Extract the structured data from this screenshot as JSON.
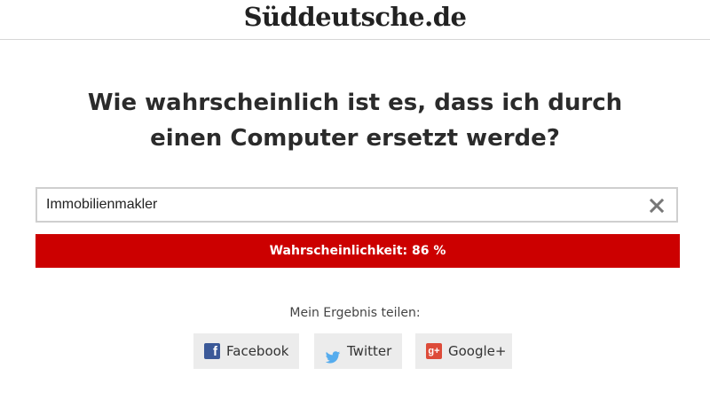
{
  "header": {
    "logo_text": "Süddeutsche.de"
  },
  "main": {
    "headline_line1": "Wie wahrscheinlich ist es, dass ich durch",
    "headline_line2": "einen Computer ersetzt werde?",
    "search": {
      "value": "Immobilienmakler",
      "clear_icon": "close-icon"
    },
    "result": {
      "text": "Wahrscheinlichkeit: 86 %",
      "probability_percent": 86,
      "bar_color": "#cc0000"
    },
    "share": {
      "label": "Mein Ergebnis teilen:",
      "buttons": [
        {
          "label": "Facebook",
          "icon": "facebook-icon",
          "color": "#3b5998"
        },
        {
          "label": "Twitter",
          "icon": "twitter-icon",
          "color": "#55acee"
        },
        {
          "label": "Google+",
          "icon": "google-plus-icon",
          "color": "#dd4b39"
        }
      ]
    }
  }
}
